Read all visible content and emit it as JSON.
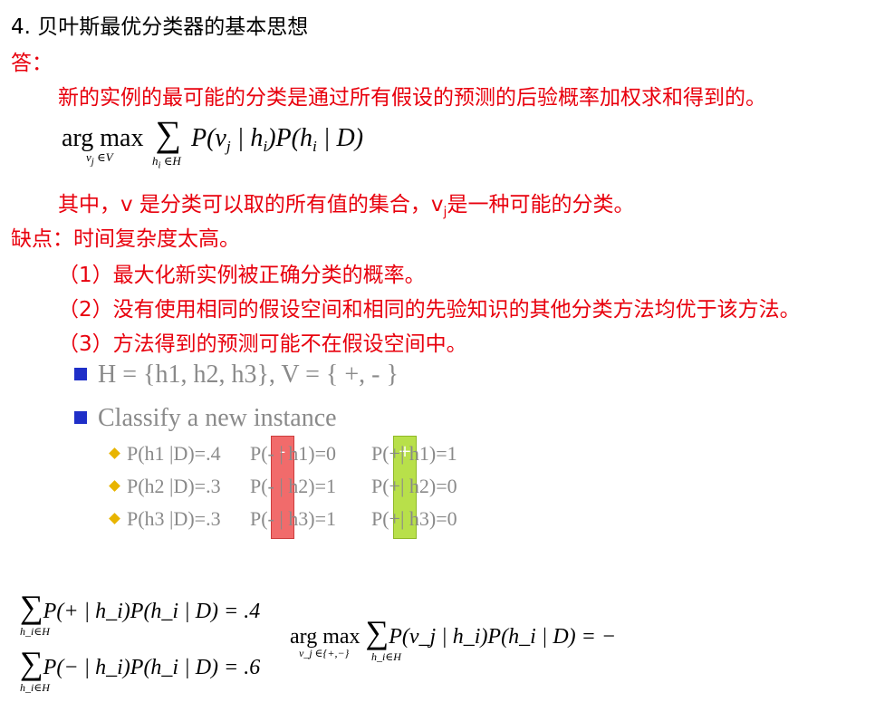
{
  "heading": "4.  贝叶斯最优分类器的基本思想",
  "answer_label": "答：",
  "answer_text": "新的实例的最可能的分类是通过所有假设的预测的后验概率加权求和得到的。",
  "formula_main": {
    "argmax": "arg max",
    "argmax_sub": "v_j ∈V",
    "sum_sub": "h_i ∈H",
    "expr": "P(v_j | h_i)P(h_i | D)"
  },
  "where_text_prefix": "其中，v 是分类可以取的所有值的集合，v",
  "where_text_sub": "j",
  "where_text_suffix": "是一种可能的分类。",
  "drawback_label": "缺点：时间复杂度太高。",
  "points": [
    "（1）最大化新实例被正确分类的概率。",
    "（2）没有使用相同的假设空间和相同的先验知识的其他分类方法均优于该方法。",
    "（3）方法得到的预测可能不在假设空间中。"
  ],
  "slide": {
    "bullet1": "H = {h1, h2, h3}, V = { +, - }",
    "bullet2": "Classify a new instance",
    "rows": [
      {
        "pd": "P(h1 |D)=.4",
        "pminus": "P(- | h1)=0",
        "pplus": "P(+| h1)=1"
      },
      {
        "pd": "P(h2 |D)=.3",
        "pminus": "P(- | h2)=1",
        "pplus": "P(+| h2)=0"
      },
      {
        "pd": "P(h3 |D)=.3",
        "pminus": "P(- | h3)=1",
        "pplus": "P(+| h3)=0"
      }
    ],
    "minus_sign": "-",
    "plus_sign": "+"
  },
  "bottom": {
    "sum_plus": "P(+ | h_i)P(h_i | D) = .4",
    "sum_minus": "P(− | h_i)P(h_i | D) = .6",
    "sum_sub": "h_i∈H",
    "argmax": "arg max",
    "argmax_sub": "v_j ∈{+,−}",
    "argmax_sum_sub": "h_i∈H",
    "argmax_expr": "P(v_j | h_i)P(h_i | D) = −"
  }
}
